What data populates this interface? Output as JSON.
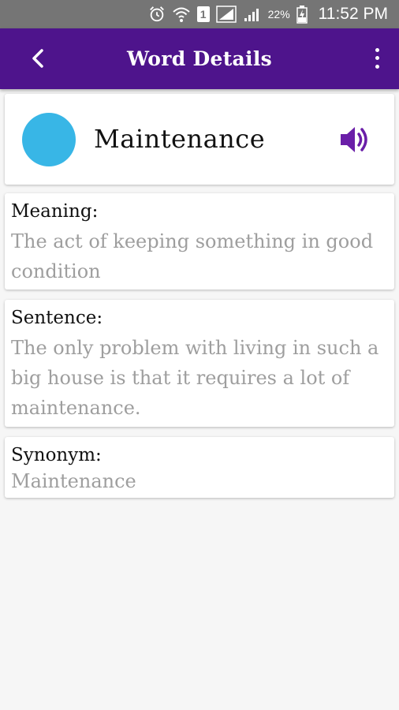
{
  "status_bar": {
    "battery_percent": "22%",
    "time": "11:52 PM",
    "sim_label": "1",
    "icons": [
      "alarm-icon",
      "wifi-icon",
      "sim-icon",
      "signal-icon",
      "signal-icon",
      "battery-icon"
    ]
  },
  "app_bar": {
    "title": "Word Details",
    "back_icon": "chevron-left-icon",
    "menu_icon": "more-vertical-icon",
    "color": "#4e148c"
  },
  "word": {
    "text": "Maintenance",
    "dot_color": "#38b6e6",
    "speaker_icon": "speaker-icon",
    "speaker_color": "#6a1ea8"
  },
  "details": {
    "meaning": {
      "label": "Meaning:",
      "value": "The act of keeping something in good condition"
    },
    "sentence": {
      "label": "Sentence:",
      "value": "The only problem with living in such a big house is that it requires a lot of maintenance."
    },
    "synonym": {
      "label": "Synonym:",
      "value": "Maintenance"
    }
  }
}
